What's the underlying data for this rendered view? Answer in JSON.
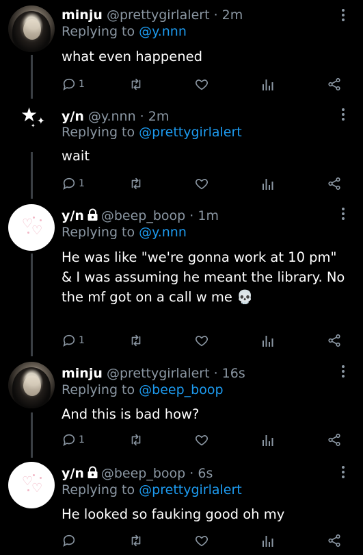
{
  "tweets": [
    {
      "name": "minju",
      "handle": "@prettygirlalert",
      "dot": "·",
      "time": "2m",
      "reply_prefix": "Replying to",
      "reply_to": "@y.nnn",
      "text": "what even happened",
      "reply_count": "1",
      "avatar": "dark-portrait",
      "locked": false
    },
    {
      "name": "y/n",
      "handle": "@y.nnn",
      "dot": "·",
      "time": "2m",
      "reply_prefix": "Replying to",
      "reply_to": "@prettygirlalert",
      "text": "wait",
      "reply_count": "1",
      "avatar": "white-stars",
      "locked": false
    },
    {
      "name": "y/n",
      "handle": "@beep_boop",
      "dot": "·",
      "time": "1m",
      "reply_prefix": "Replying to",
      "reply_to": "@y.nnn",
      "text": "He was like \"we're gonna work at 10 pm\" & I was assuming he meant the library. No the mf got on a call w me 💀",
      "reply_count": "1",
      "avatar": "pink-hearts",
      "locked": true
    },
    {
      "name": "minju",
      "handle": "@prettygirlalert",
      "dot": "·",
      "time": "16s",
      "reply_prefix": "Replying to",
      "reply_to": "@beep_boop",
      "text": "And this is bad how?",
      "reply_count": "1",
      "avatar": "dark-portrait",
      "locked": false
    },
    {
      "name": "y/n",
      "handle": "@beep_boop",
      "dot": "·",
      "time": "6s",
      "reply_prefix": "Replying to",
      "reply_to": "@prettygirlalert",
      "text": "He looked so fauking good oh my",
      "reply_count": "",
      "avatar": "pink-hearts",
      "locked": true
    }
  ],
  "icons": {
    "reply": "reply-icon",
    "retweet": "retweet-icon",
    "like": "heart-icon",
    "analytics": "analytics-icon",
    "share": "share-icon",
    "menu": "more-options-icon",
    "lock": "lock-icon"
  },
  "colors": {
    "background": "#000000",
    "text": "#ffffff",
    "muted": "#8b97a3",
    "link": "#1d9bf0",
    "thread_line": "#3a3f44"
  }
}
